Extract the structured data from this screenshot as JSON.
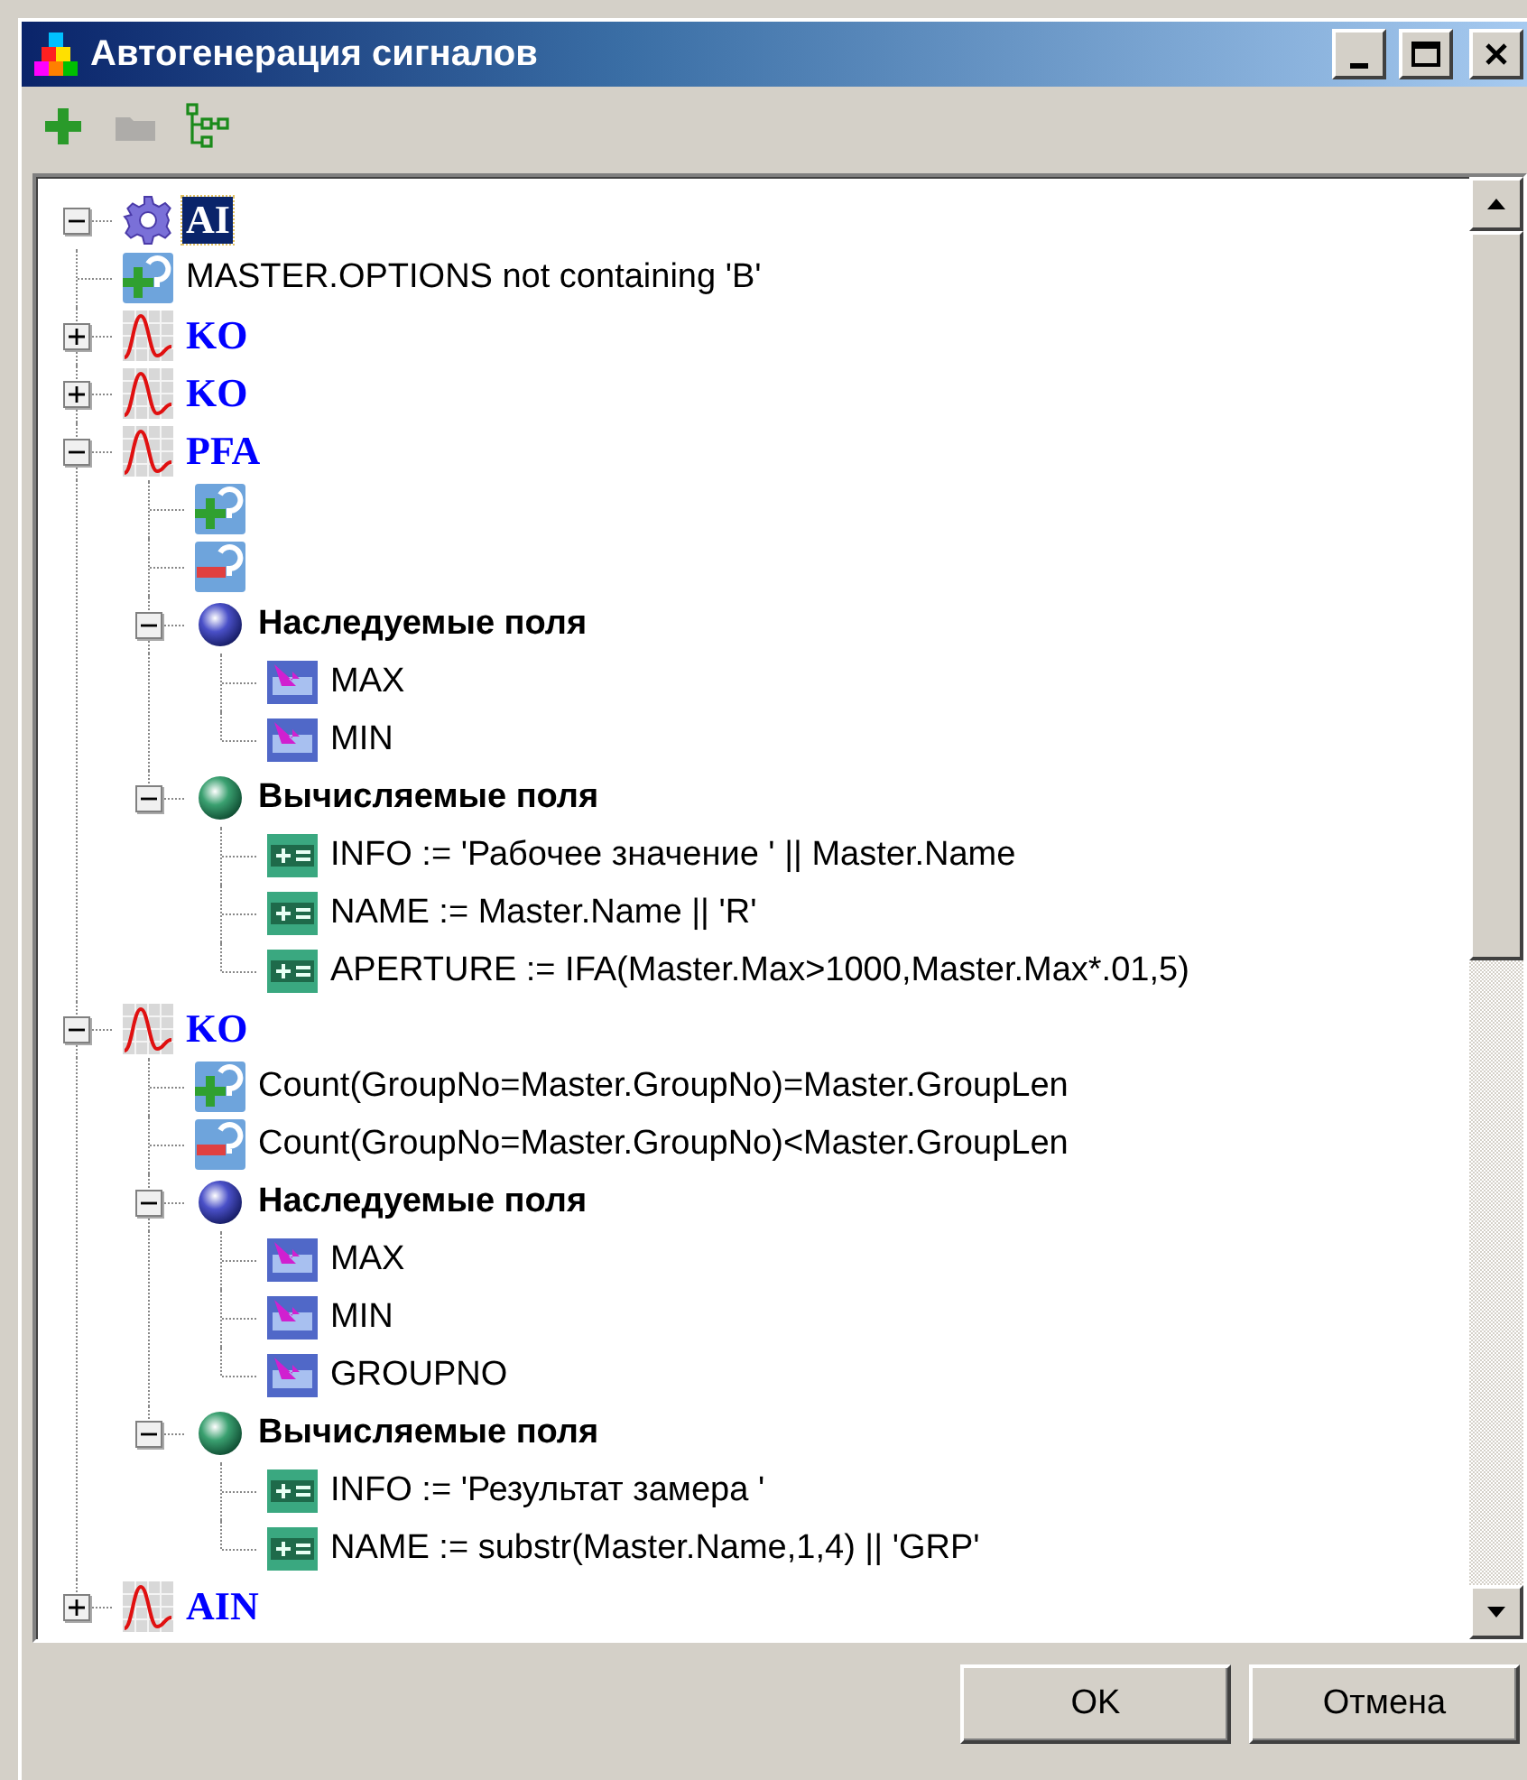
{
  "window": {
    "title": "Автогенерация сигналов"
  },
  "toolbar": [
    {
      "kind": "add",
      "disabled": false
    },
    {
      "kind": "remove",
      "disabled": true
    },
    {
      "kind": "tree",
      "disabled": false
    }
  ],
  "tree": [
    {
      "kind": "category",
      "label": "AI",
      "expanded": true,
      "selected": true,
      "children": [
        {
          "kind": "condition_include",
          "label": "MASTER.OPTIONS not containing 'B'",
          "selected": false
        },
        {
          "kind": "signal",
          "label": "KO",
          "expanded": false,
          "selected": false
        },
        {
          "kind": "signal",
          "label": "KO",
          "expanded": false,
          "selected": false
        },
        {
          "kind": "signal",
          "label": "PFA",
          "expanded": true,
          "selected": false,
          "children": [
            {
              "kind": "condition_include",
              "selected": false
            },
            {
              "kind": "condition_exclude",
              "selected": false
            },
            {
              "kind": "inherited_group",
              "label": "Наследуемые поля",
              "expanded": true,
              "selected": false,
              "children": [
                {
                  "kind": "inherited_field",
                  "label": "MAX",
                  "selected": false
                },
                {
                  "kind": "inherited_field",
                  "label": "MIN",
                  "selected": false
                }
              ]
            },
            {
              "kind": "computed_group",
              "label": "Вычисляемые поля",
              "expanded": true,
              "selected": false,
              "children": [
                {
                  "kind": "computed_field",
                  "label": "INFO := 'Рабочее значение ' || Master.Name",
                  "selected": false
                },
                {
                  "kind": "computed_field",
                  "label": "NAME := Master.Name || 'R'",
                  "selected": false
                },
                {
                  "kind": "computed_field",
                  "label": "APERTURE := IFA(Master.Max>1000,Master.Max*.01,5)",
                  "selected": false
                }
              ]
            }
          ]
        },
        {
          "kind": "signal",
          "label": "KO",
          "expanded": true,
          "selected": false,
          "children": [
            {
              "kind": "condition_include",
              "label": "Count(GroupNo=Master.GroupNo)=Master.GroupLen",
              "selected": false
            },
            {
              "kind": "condition_exclude",
              "label": "Count(GroupNo=Master.GroupNo)<Master.GroupLen",
              "selected": false
            },
            {
              "kind": "inherited_group",
              "label": "Наследуемые поля",
              "expanded": true,
              "selected": false,
              "children": [
                {
                  "kind": "inherited_field",
                  "label": "MAX",
                  "selected": false
                },
                {
                  "kind": "inherited_field",
                  "label": "MIN",
                  "selected": false
                },
                {
                  "kind": "inherited_field",
                  "label": "GROUPNO",
                  "selected": false
                }
              ]
            },
            {
              "kind": "computed_group",
              "label": "Вычисляемые поля",
              "expanded": true,
              "selected": false,
              "children": [
                {
                  "kind": "computed_field",
                  "label": "INFO := 'Результат замера '",
                  "selected": false
                },
                {
                  "kind": "computed_field",
                  "label": "NAME := substr(Master.Name,1,4) || 'GRP'",
                  "selected": false
                }
              ]
            }
          ]
        },
        {
          "kind": "signal",
          "label": "AIN",
          "expanded": false,
          "selected": false
        }
      ]
    }
  ],
  "buttons": [
    {
      "label": "OK"
    },
    {
      "label": "Отмена"
    }
  ]
}
